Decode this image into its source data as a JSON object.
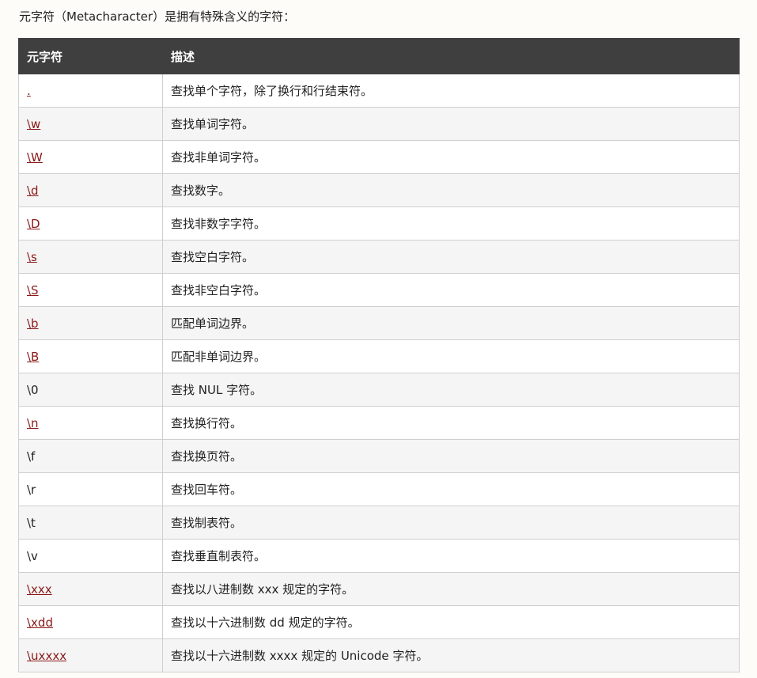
{
  "intro": "元字符（Metacharacter）是拥有特殊含义的字符：",
  "table": {
    "headers": [
      "元字符",
      "描述"
    ],
    "rows": [
      {
        "char": ".",
        "desc": "查找单个字符，除了换行和行结束符。",
        "link": true
      },
      {
        "char": "\\w",
        "desc": "查找单词字符。",
        "link": true
      },
      {
        "char": "\\W",
        "desc": "查找非单词字符。",
        "link": true
      },
      {
        "char": "\\d",
        "desc": "查找数字。",
        "link": true
      },
      {
        "char": "\\D",
        "desc": "查找非数字字符。",
        "link": true
      },
      {
        "char": "\\s",
        "desc": "查找空白字符。",
        "link": true
      },
      {
        "char": "\\S",
        "desc": "查找非空白字符。",
        "link": true
      },
      {
        "char": "\\b",
        "desc": "匹配单词边界。",
        "link": true
      },
      {
        "char": "\\B",
        "desc": "匹配非单词边界。",
        "link": true
      },
      {
        "char": "\\0",
        "desc": "查找 NUL 字符。",
        "link": false
      },
      {
        "char": "\\n",
        "desc": "查找换行符。",
        "link": true
      },
      {
        "char": "\\f",
        "desc": "查找换页符。",
        "link": false
      },
      {
        "char": "\\r",
        "desc": "查找回车符。",
        "link": false
      },
      {
        "char": "\\t",
        "desc": "查找制表符。",
        "link": false
      },
      {
        "char": "\\v",
        "desc": "查找垂直制表符。",
        "link": false
      },
      {
        "char": "\\xxx",
        "desc": "查找以八进制数 xxx 规定的字符。",
        "link": true
      },
      {
        "char": "\\xdd",
        "desc": "查找以十六进制数 dd 规定的字符。",
        "link": true
      },
      {
        "char": "\\uxxxx",
        "desc": "查找以十六进制数 xxxx 规定的 Unicode 字符。",
        "link": true
      }
    ]
  },
  "colors": {
    "header_bg": "#3f3f3f",
    "link": "#8b1a1a",
    "row_alt": "#f5f5f5"
  }
}
